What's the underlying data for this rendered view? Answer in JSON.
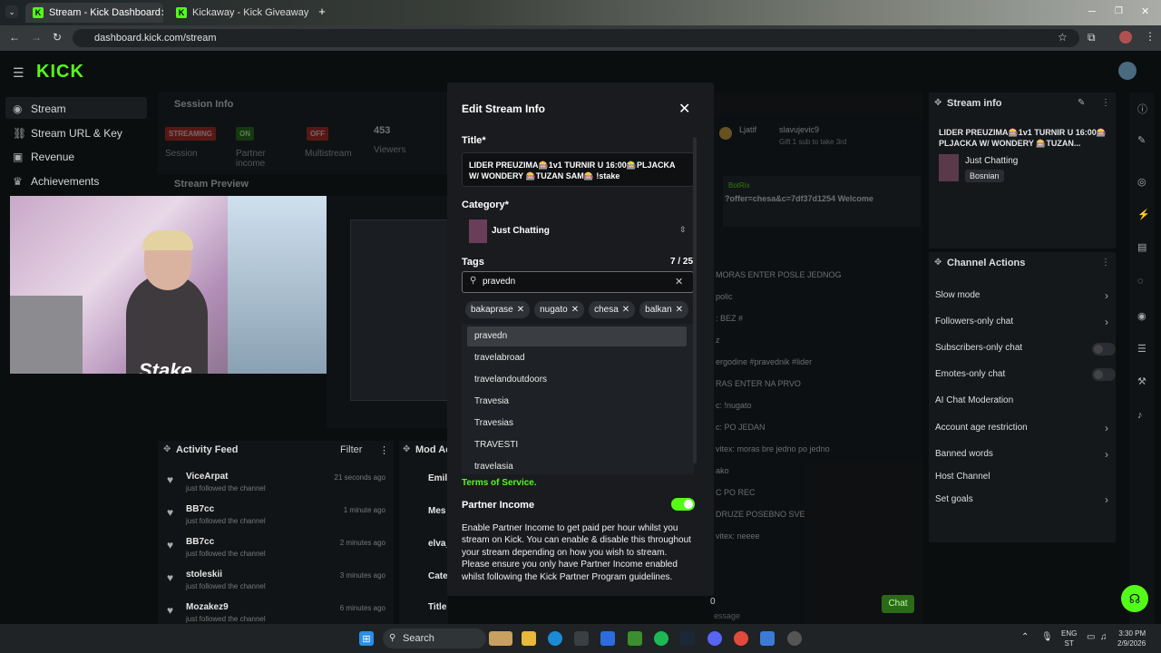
{
  "browser": {
    "tabs": [
      {
        "label": "Stream - Kick Dashboard"
      },
      {
        "label": "Kickaway - Kick Giveaway To..."
      }
    ],
    "new_tab": "+",
    "url": "dashboard.kick.com/stream"
  },
  "app": {
    "logo": "KICK",
    "sidebar": [
      {
        "label": "Stream"
      },
      {
        "label": "Stream URL & Key"
      },
      {
        "label": "Revenue"
      },
      {
        "label": "Achievements"
      }
    ],
    "session_info": {
      "title": "Session Info",
      "streaming_badge": "STREAMING",
      "on_badge": "ON",
      "off_badge": "OFF",
      "viewers_value": "453",
      "session_label": "Session",
      "partner_label": "Partner income",
      "multistream_label": "Multistream",
      "viewers_label": "Viewers"
    },
    "stream_preview": {
      "title": "Stream Preview",
      "overlay_text": "Stake"
    },
    "activity_feed": {
      "title": "Activity Feed",
      "filter": "Filter",
      "items": [
        {
          "name": "ViceArpat",
          "sub": "just followed the channel",
          "time": "21 seconds ago"
        },
        {
          "name": "BB7cc",
          "sub": "just followed the channel",
          "time": "1 minute ago"
        },
        {
          "name": "BB7cc",
          "sub": "just followed the channel",
          "time": "2 minutes ago"
        },
        {
          "name": "stoleskii",
          "sub": "just followed the channel",
          "time": "3 minutes ago"
        },
        {
          "name": "Mozakez9",
          "sub": "just followed the channel",
          "time": "6 minutes ago"
        }
      ]
    },
    "mod_actions": {
      "title": "Mod Ac",
      "items": [
        "Emil",
        "Mes",
        "elva_",
        "Cate",
        "Title"
      ]
    },
    "chat": {
      "top_users": [
        "Ljatif",
        "slavujevic9"
      ],
      "gift_text": "Gift 1 sub to take 3rd",
      "pinned_user": "BotRix",
      "pinned_text": "?offer=chesa&c=7df37d1254 Welcome",
      "messages": [
        "MORAS ENTER POSLE JEDNOG",
        "polic",
        ": BEZ #",
        "z",
        "ergodine #pravednik #lider",
        "RAS ENTER NA PRVO",
        "c: !nugato",
        "c: PO JEDAN",
        "vitex: moras bre jedno po jedno",
        "ako",
        "C PO REC",
        "DRUZE POSEBNO SVE",
        "vitex: neeee"
      ],
      "input_placeholder": "essage",
      "count": "0",
      "chat_button": "Chat"
    },
    "stream_info_panel": {
      "title": "Stream info",
      "stream_title": "LIDER PREUZIMA🎰1v1 TURNIR U 16:00🎰PLJACKA W/ WONDERY 🎰TUZAN...",
      "category": "Just Chatting",
      "language": "Bosnian"
    },
    "channel_actions": {
      "title": "Channel Actions",
      "items": [
        {
          "label": "Slow mode"
        },
        {
          "label": "Followers-only chat"
        },
        {
          "label": "Subscribers-only chat"
        },
        {
          "label": "Emotes-only chat"
        },
        {
          "label": "AI Chat Moderation"
        },
        {
          "label": "Account age restriction"
        },
        {
          "label": "Banned words"
        },
        {
          "label": "Host Channel"
        },
        {
          "label": "Set goals"
        }
      ]
    }
  },
  "modal": {
    "title": "Edit Stream Info",
    "title_label": "Title*",
    "title_value": "LIDER PREUZIMA🎰1v1 TURNIR U 16:00🎰PLJACKA W/ WONDERY 🎰TUZAN SAM🎰 !stake",
    "category_label": "Category*",
    "category_value": "Just Chatting",
    "tags_label": "Tags",
    "tags_count": "7 / 25",
    "tag_input": "pravedn",
    "tags": [
      "bakaprase",
      "nugato",
      "chesa",
      "balkan"
    ],
    "suggestions": [
      "pravedn",
      "travelabroad",
      "travelandoutdoors",
      "Travesia",
      "Travesias",
      "TRAVESTI",
      "travelasia"
    ],
    "terms_link": "Terms of Service.",
    "partner_income_label": "Partner Income",
    "partner_income_on": true,
    "partner_text": "Enable Partner Income to get paid per hour whilst you stream on Kick. You can enable & disable this throughout your stream depending on how you wish to stream. Please ensure you only have Partner Income enabled whilst following the Kick Partner Program guidelines."
  },
  "taskbar": {
    "search": "Search",
    "lang_top": "ENG",
    "lang_bottom": "ST",
    "time": "3:30 PM",
    "date": "2/9/2026"
  }
}
